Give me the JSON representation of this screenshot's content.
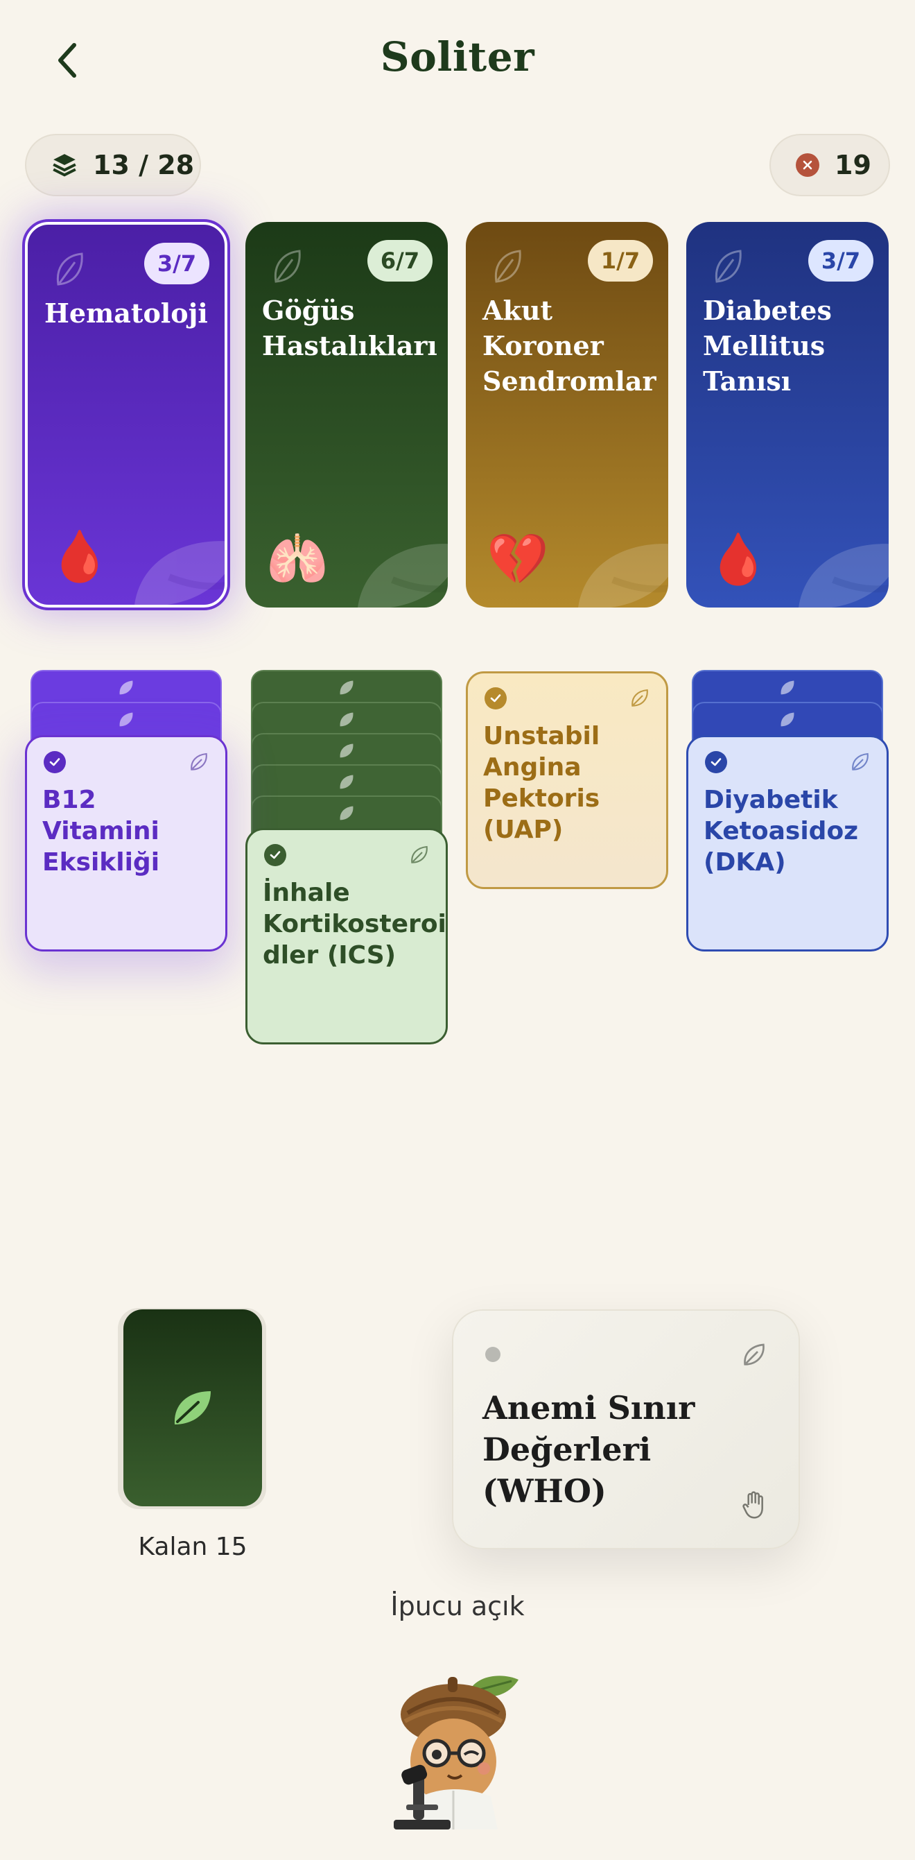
{
  "header": {
    "title": "Soliter"
  },
  "stats": {
    "progress": "13 / 28",
    "errors": "19"
  },
  "foundations": [
    {
      "name": "Hematoloji",
      "progress": "3/7",
      "emoji": "🩸"
    },
    {
      "name": "Göğüs Hastalıkları",
      "progress": "6/7",
      "emoji": "🫁"
    },
    {
      "name": "Akut Koroner Sendromlar",
      "progress": "1/7",
      "emoji": "💔"
    },
    {
      "name": "Diabetes Mellitus Tanısı",
      "progress": "3/7",
      "emoji": "🩸"
    }
  ],
  "tableau": [
    {
      "label": "B12 Vitamini Eksikliği"
    },
    {
      "label": "İnhale Kortikosteroi dler (ICS)"
    },
    {
      "label": "Unstabil Angina Pektoris (UAP)"
    },
    {
      "label": "Diyabetik Ketoasidoz (DKA)"
    }
  ],
  "stock": {
    "label": "Kalan 15"
  },
  "waste": {
    "title": "Anemi Sınır Değerleri (WHO)"
  },
  "hint": {
    "label": "İpucu açık"
  },
  "colors": {
    "background": "#f8f4ec",
    "purple": "#6a33d1",
    "green": "#3b5e31",
    "gold": "#b48a2c",
    "blue": "#2f4cb2"
  },
  "icons": [
    "back-icon",
    "stack-icon",
    "error-icon",
    "leaf-icon",
    "check-icon",
    "hand-icon"
  ]
}
